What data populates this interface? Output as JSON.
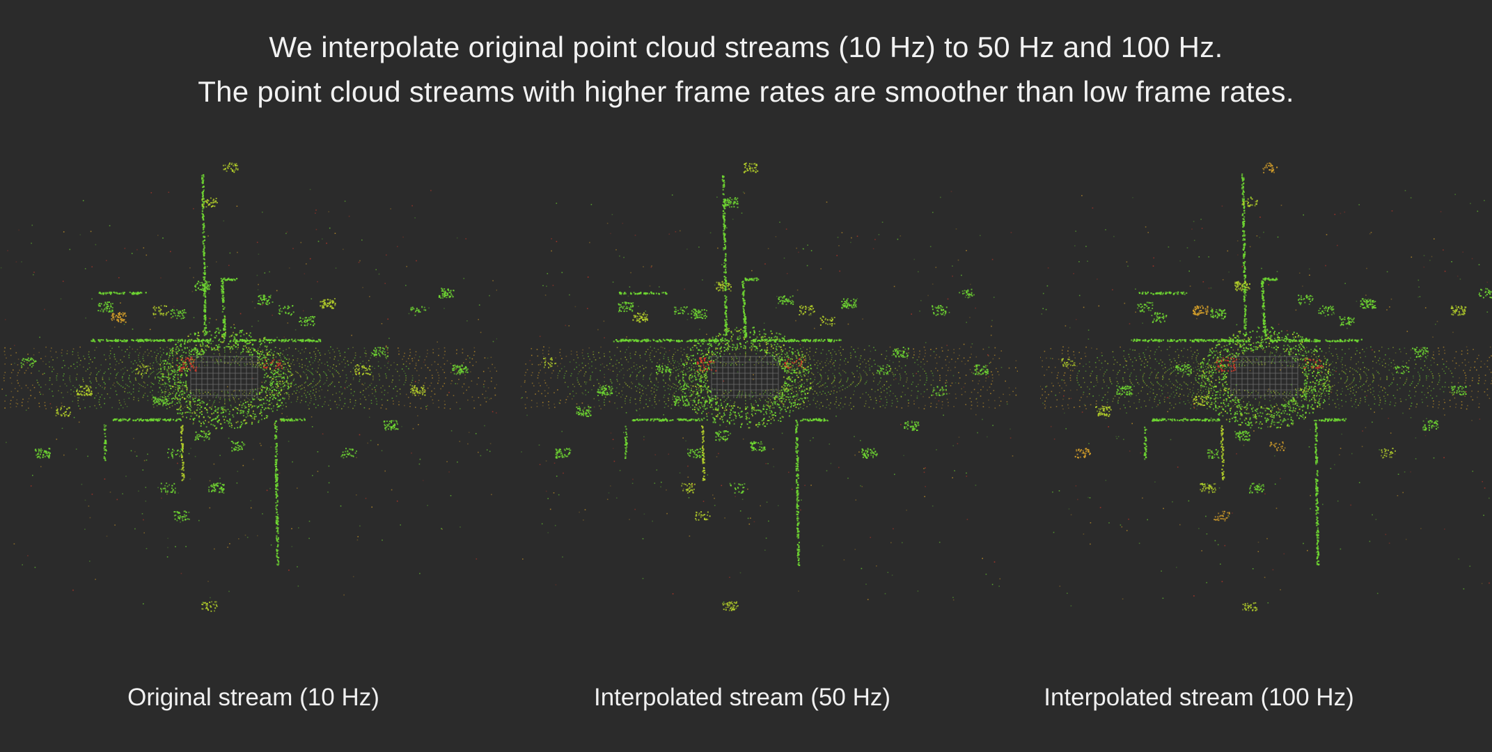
{
  "title": {
    "line1": "We interpolate original point cloud streams (10 Hz) to 50 Hz and 100 Hz.",
    "line2": "The point cloud streams with higher frame rates are smoother than low frame rates."
  },
  "panels": [
    {
      "caption": "Original stream (10 Hz)"
    },
    {
      "caption": "Interpolated stream (50 Hz)"
    },
    {
      "caption": "Interpolated stream (100 Hz)"
    }
  ],
  "colors": {
    "background": "#2b2b2b",
    "points_primary": "#6fd832",
    "points_secondary": "#b6d22a",
    "points_far": "#d9a22a",
    "points_hot": "#d43a2a",
    "grid": "#8a8a8a"
  }
}
